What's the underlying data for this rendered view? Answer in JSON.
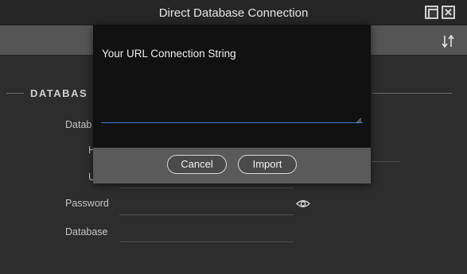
{
  "window": {
    "title": "Direct Database Connection",
    "maximize_icon": "maximize-icon",
    "close_icon": "close-icon",
    "close_glyph": "✕"
  },
  "toolbar": {
    "sort_icon": "sort-arrows-icon"
  },
  "section": {
    "title": "DATABAS"
  },
  "form": {
    "database_type_label": "Datab",
    "host_label": "H",
    "user_label": "U",
    "password_label": "Password",
    "database_label": "Database",
    "password_toggle_icon": "eye-icon"
  },
  "modal": {
    "label": "Your URL Connection String",
    "textarea_value": "",
    "cancel_label": "Cancel",
    "import_label": "Import"
  },
  "colors": {
    "background": "#2d2d2d",
    "modal_background": "#111111",
    "toolbar": "#555555",
    "focus_underline": "#3e7bd6"
  }
}
